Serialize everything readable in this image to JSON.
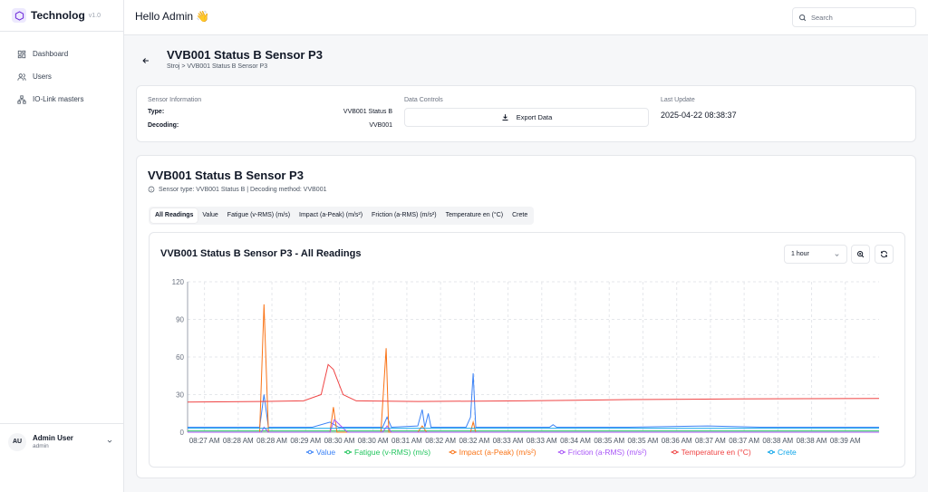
{
  "app": {
    "name": "Technolog",
    "version": "v1.0"
  },
  "sidebar": {
    "items": [
      {
        "label": "Dashboard",
        "icon": "dashboard-icon"
      },
      {
        "label": "Users",
        "icon": "users-icon"
      },
      {
        "label": "IO-Link masters",
        "icon": "network-icon"
      }
    ],
    "user": {
      "initials": "AU",
      "name": "Admin User",
      "role": "admin"
    }
  },
  "header": {
    "greeting": "Hello Admin 👋",
    "search_placeholder": "Search"
  },
  "page": {
    "title": "VVB001 Status B Sensor P3",
    "breadcrumb": "Stroj > VVB001 Status B Sensor P3"
  },
  "info": {
    "sensor_info_label": "Sensor Information",
    "type_key": "Type:",
    "type_val": "VVB001 Status B",
    "decoding_key": "Decoding:",
    "decoding_val": "VVB001",
    "data_controls_label": "Data Controls",
    "export_label": "Export Data",
    "last_update_label": "Last Update",
    "last_update_val": "2025-04-22 08:38:37"
  },
  "sensor_card": {
    "title": "VVB001 Status B Sensor P3",
    "subtitle": "Sensor type: VVB001 Status B | Decoding method: VVB001",
    "tabs": [
      "All Readings",
      "Value",
      "Fatigue (v-RMS) (m/s)",
      "Impact (a-Peak) (m/s²)",
      "Friction (a-RMS) (m/s²)",
      "Temperature en (°C)",
      "Crete"
    ],
    "active_tab": 0
  },
  "chart_panel": {
    "title": "VVB001 Status B Sensor P3 - All Readings",
    "range": "1 hour"
  },
  "chart_data": {
    "type": "line",
    "title": "VVB001 Status B Sensor P3 - All Readings",
    "ylim": [
      0,
      120
    ],
    "yticks": [
      0,
      30,
      60,
      90,
      120
    ],
    "xlim": [
      "08:26:38",
      "08:39:45"
    ],
    "xticks": [
      "08:27 AM",
      "08:28 AM",
      "08:28 AM",
      "08:29 AM",
      "08:30 AM",
      "08:30 AM",
      "08:31 AM",
      "08:32 AM",
      "08:32 AM",
      "08:33 AM",
      "08:33 AM",
      "08:34 AM",
      "08:35 AM",
      "08:35 AM",
      "08:36 AM",
      "08:37 AM",
      "08:37 AM",
      "08:38 AM",
      "08:38 AM",
      "08:39 AM"
    ],
    "grid": true,
    "legend_position": "bottom",
    "series": [
      {
        "name": "Value",
        "color": "#3b82f6",
        "points": [
          [
            "08:26:38",
            4
          ],
          [
            "08:27:40",
            4
          ],
          [
            "08:28:00",
            4
          ],
          [
            "08:28:05",
            30
          ],
          [
            "08:28:10",
            4
          ],
          [
            "08:29:00",
            4
          ],
          [
            "08:29:20",
            8
          ],
          [
            "08:29:30",
            4
          ],
          [
            "08:30:20",
            4
          ],
          [
            "08:30:25",
            12
          ],
          [
            "08:30:30",
            4
          ],
          [
            "08:31:00",
            5
          ],
          [
            "08:31:05",
            18
          ],
          [
            "08:31:08",
            4
          ],
          [
            "08:31:12",
            15
          ],
          [
            "08:31:15",
            4
          ],
          [
            "08:31:55",
            4
          ],
          [
            "08:32:00",
            12
          ],
          [
            "08:32:03",
            47
          ],
          [
            "08:32:06",
            4
          ],
          [
            "08:33:30",
            4
          ],
          [
            "08:33:34",
            6
          ],
          [
            "08:33:38",
            4
          ],
          [
            "08:35:00",
            4
          ],
          [
            "08:36:30",
            5
          ],
          [
            "08:37:30",
            4
          ],
          [
            "08:39:45",
            4
          ]
        ]
      },
      {
        "name": "Fatigue (v-RMS) (m/s)",
        "color": "#22c55e",
        "points": [
          [
            "08:26:38",
            1
          ],
          [
            "08:39:45",
            1
          ]
        ]
      },
      {
        "name": "Impact (a-Peak) (m/s²)",
        "color": "#f97316",
        "points": [
          [
            "08:26:38",
            0
          ],
          [
            "08:28:00",
            0
          ],
          [
            "08:28:05",
            102
          ],
          [
            "08:28:10",
            0
          ],
          [
            "08:29:20",
            0
          ],
          [
            "08:29:24",
            20
          ],
          [
            "08:29:28",
            0
          ],
          [
            "08:30:18",
            0
          ],
          [
            "08:30:24",
            67
          ],
          [
            "08:30:27",
            0
          ],
          [
            "08:31:00",
            0
          ],
          [
            "08:31:05",
            5
          ],
          [
            "08:31:10",
            0
          ],
          [
            "08:32:00",
            0
          ],
          [
            "08:32:03",
            8
          ],
          [
            "08:32:06",
            0
          ],
          [
            "08:39:45",
            0
          ]
        ]
      },
      {
        "name": "Friction (a-RMS) (m/s²)",
        "color": "#a855f7",
        "points": [
          [
            "08:26:38",
            0
          ],
          [
            "08:28:02",
            0
          ],
          [
            "08:28:05",
            4
          ],
          [
            "08:28:10",
            0
          ],
          [
            "08:29:20",
            0
          ],
          [
            "08:29:25",
            10
          ],
          [
            "08:29:40",
            0
          ],
          [
            "08:30:20",
            0
          ],
          [
            "08:30:25",
            5
          ],
          [
            "08:30:30",
            0
          ],
          [
            "08:39:45",
            0
          ]
        ]
      },
      {
        "name": "Temperature en (°C)",
        "color": "#ef4444",
        "points": [
          [
            "08:26:38",
            24
          ],
          [
            "08:28:00",
            24.5
          ],
          [
            "08:28:50",
            25
          ],
          [
            "08:29:10",
            30
          ],
          [
            "08:29:18",
            54
          ],
          [
            "08:29:24",
            50
          ],
          [
            "08:29:35",
            30
          ],
          [
            "08:29:50",
            25
          ],
          [
            "08:31:00",
            24.5
          ],
          [
            "08:33:00",
            25
          ],
          [
            "08:35:00",
            26
          ],
          [
            "08:37:00",
            26.5
          ],
          [
            "08:39:45",
            27
          ]
        ]
      },
      {
        "name": "Crete",
        "color": "#0ea5e9",
        "points": [
          [
            "08:26:38",
            3
          ],
          [
            "08:39:45",
            3
          ]
        ]
      }
    ]
  }
}
